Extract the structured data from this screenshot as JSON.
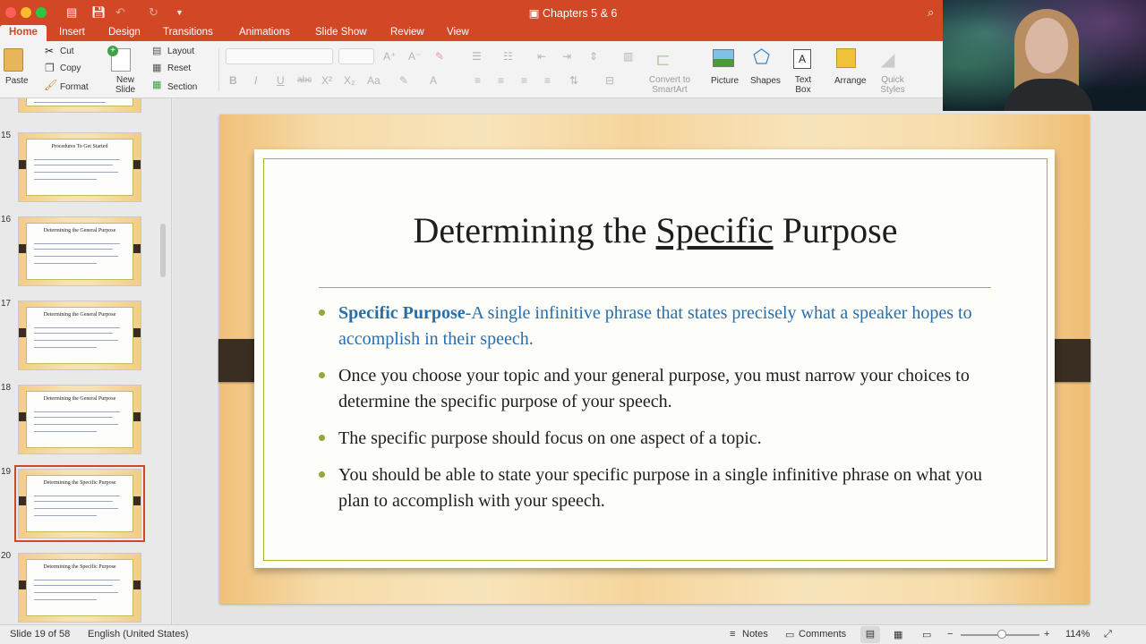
{
  "window": {
    "title": "Chapters 5 & 6"
  },
  "tabs": [
    "Home",
    "Insert",
    "Design",
    "Transitions",
    "Animations",
    "Slide Show",
    "Review",
    "View"
  ],
  "ribbon": {
    "paste": "Paste",
    "cut": "Cut",
    "copy": "Copy",
    "format": "Format",
    "new_slide": "New Slide",
    "layout": "Layout",
    "reset": "Reset",
    "section": "Section",
    "convert_smartart": "Convert to SmartArt",
    "picture": "Picture",
    "shapes": "Shapes",
    "text_box": "Text Box",
    "arrange": "Arrange",
    "quick_styles": "Quick Styles"
  },
  "thumbnails": [
    {
      "num": "15",
      "title": "Procedures To Get Started"
    },
    {
      "num": "16",
      "title": "Determining the General Purpose"
    },
    {
      "num": "17",
      "title": "Determining the General Purpose"
    },
    {
      "num": "18",
      "title": "Determining the General Purpose"
    },
    {
      "num": "19",
      "title": "Determining the Specific Purpose",
      "selected": true
    },
    {
      "num": "20",
      "title": "Determining the Specific Purpose"
    }
  ],
  "slide": {
    "title_pre": "Determining the ",
    "title_underlined": "Specific",
    "title_post": " Purpose",
    "bullets": [
      {
        "bold": "Specific Purpose",
        "text": "-A single infinitive phrase that states precisely what a speaker hopes to accomplish in their speech."
      },
      {
        "text": "Once you choose your topic and your general purpose, you must narrow your choices to determine the specific purpose of your speech."
      },
      {
        "text": "The specific purpose should focus on one aspect of a topic."
      },
      {
        "text": "You should be able to state your specific purpose in a single infinitive phrase on what you plan to accomplish with your speech."
      }
    ]
  },
  "status": {
    "slide_info": "Slide 19 of 58",
    "language": "English (United States)",
    "notes": "Notes",
    "comments": "Comments",
    "zoom": "114%"
  },
  "colors": {
    "accent": "#d24726",
    "title_blue": "#2a6ea9",
    "bullet_green": "#8fa93a"
  }
}
